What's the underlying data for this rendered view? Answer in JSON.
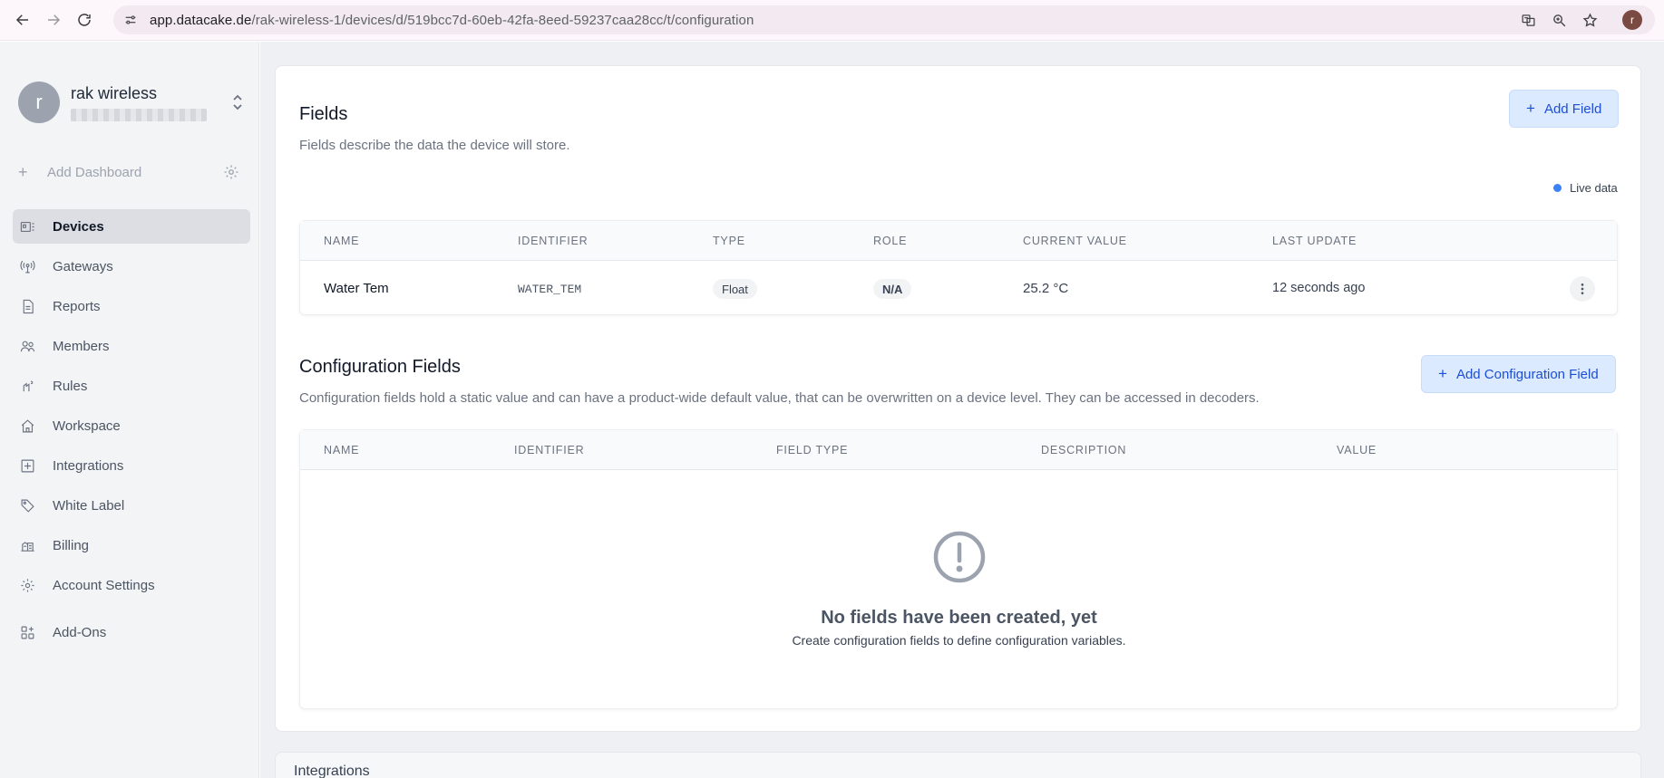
{
  "browser": {
    "url_domain": "app.datacake.de",
    "url_path": "/rak-wireless-1/devices/d/519bcc7d-60eb-42fa-8eed-59237caa28cc/t/configuration",
    "profile_initial": "r"
  },
  "workspace": {
    "initial": "r",
    "name": "rak wireless"
  },
  "sidebar": {
    "add_dashboard": "Add Dashboard",
    "items": [
      {
        "label": "Devices",
        "icon": "devices-icon",
        "active": true
      },
      {
        "label": "Gateways",
        "icon": "gateway-antenna-icon"
      },
      {
        "label": "Reports",
        "icon": "document-icon"
      },
      {
        "label": "Members",
        "icon": "users-icon"
      },
      {
        "label": "Rules",
        "icon": "rules-icon"
      },
      {
        "label": "Workspace",
        "icon": "home-icon"
      },
      {
        "label": "Integrations",
        "icon": "plus-square-icon"
      },
      {
        "label": "White Label",
        "icon": "tag-icon"
      },
      {
        "label": "Billing",
        "icon": "billing-icon"
      },
      {
        "label": "Account Settings",
        "icon": "gear-icon"
      },
      {
        "label": "Add-Ons",
        "icon": "add-ons-icon"
      }
    ]
  },
  "fields": {
    "title": "Fields",
    "description": "Fields describe the data the device will store.",
    "add_button": "Add Field",
    "live_label": "Live data",
    "columns": [
      "NAME",
      "IDENTIFIER",
      "TYPE",
      "ROLE",
      "CURRENT VALUE",
      "LAST UPDATE"
    ],
    "rows": [
      {
        "name": "Water Tem",
        "identifier": "WATER_TEM",
        "type": "Float",
        "role": "N/A",
        "current_value": "25.2 °C",
        "last_update": "12 seconds ago"
      }
    ]
  },
  "config_fields": {
    "title": "Configuration Fields",
    "description": "Configuration fields hold a static value and can have a product-wide default value, that can be overwritten on a device level. They can be accessed in decoders.",
    "add_button": "Add Configuration Field",
    "columns": [
      "NAME",
      "IDENTIFIER",
      "FIELD TYPE",
      "DESCRIPTION",
      "VALUE"
    ],
    "empty_title": "No fields have been created, yet",
    "empty_desc": "Create configuration fields to define configuration variables."
  },
  "next_section_peek": "Integrations"
}
